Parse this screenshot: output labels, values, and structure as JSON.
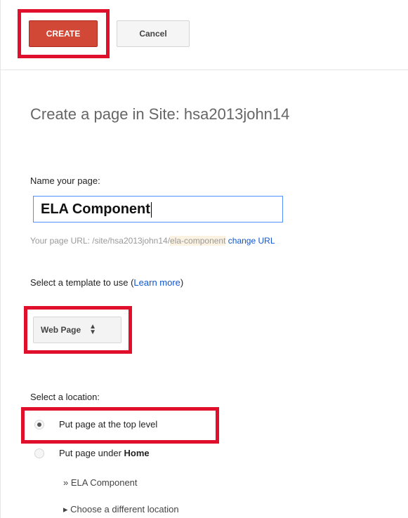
{
  "toolbar": {
    "create_label": "CREATE",
    "cancel_label": "Cancel"
  },
  "page_title": "Create a page in Site: hsa2013john14",
  "name_section": {
    "label": "Name your page:",
    "value": "ELA Component",
    "url_prefix": "Your page URL: /site/hsa2013john14/",
    "url_slug": "ela-component",
    "change_url_label": "change URL"
  },
  "template_section": {
    "label_prefix": "Select a template to use (",
    "learn_more_label": "Learn more",
    "label_suffix": ")",
    "selected_value": "Web Page"
  },
  "location_section": {
    "label": "Select a location:",
    "options": [
      {
        "label": "Put page at the top level",
        "checked": true
      },
      {
        "label_prefix": "Put page under ",
        "label_bold": "Home",
        "checked": false
      }
    ],
    "path_item": "» ELA Component",
    "choose_other_label": "▸ Choose a different location"
  },
  "colors": {
    "create_button": "#d14836",
    "highlight": "#e0102c",
    "link": "#1155cc"
  }
}
